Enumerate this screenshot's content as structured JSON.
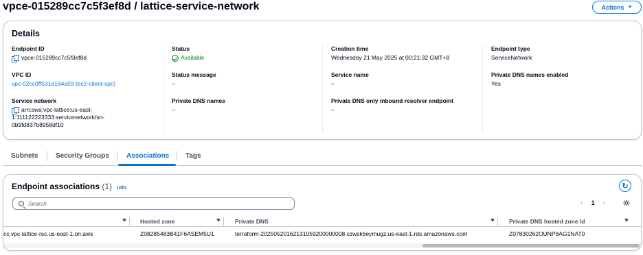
{
  "header": {
    "title": "vpce-015289cc7c5f3ef8d / lattice-service-network",
    "actions_label": "Actions"
  },
  "details": {
    "title": "Details",
    "endpoint_id_label": "Endpoint ID",
    "endpoint_id": "vpce-015289cc7c5f3ef8d",
    "vpc_id_label": "VPC ID",
    "vpc_id": "vpc-02cc0ff531e164a59 (ec2-client-vpc)",
    "service_network_label": "Service network",
    "service_network_lines": [
      "arn:aws:vpc-lattice:us-east-",
      "1:111122223333:servicenetwork/sn-",
      "0b9fd837b8958df10"
    ],
    "status_label": "Status",
    "status": "Available",
    "status_message_label": "Status message",
    "status_message": "–",
    "private_dns_names_label": "Private DNS names",
    "private_dns_names": "–",
    "creation_time_label": "Creation time",
    "creation_time": "Wednesday 21 May 2025 at 00:21:32 GMT+8",
    "service_name_label": "Service name",
    "service_name": "–",
    "private_dns_inbound_label": "Private DNS only inbound resolver endpoint",
    "private_dns_inbound": "–",
    "endpoint_type_label": "Endpoint type",
    "endpoint_type": "ServiceNetwork",
    "private_dns_enabled_label": "Private DNS names enabled",
    "private_dns_enabled": "Yes"
  },
  "tabs": [
    {
      "label": "Subnets"
    },
    {
      "label": "Security Groups"
    },
    {
      "label": "Associations",
      "active": true
    },
    {
      "label": "Tags"
    }
  ],
  "associations": {
    "title": "Endpoint associations",
    "count": "(1)",
    "info": "Info",
    "search_placeholder": "Search",
    "page": "1",
    "columns": [
      "Hosted zone",
      "Private DNS",
      "Private DNS hosted zone Id"
    ],
    "rows": [
      {
        "dns_name": "cc.vpc-lattice-rsc.us-east-1.on.aws",
        "hosted_zone": "Z08285483B41F6ASEM5U1",
        "private_dns": "terraform-20250520162131059200000008.czwsk6eymugz.us-east-1.rds.amazonaws.com",
        "private_dns_hosted_zone_id": "Z07830262OUNP8AG1NAT0"
      }
    ]
  }
}
